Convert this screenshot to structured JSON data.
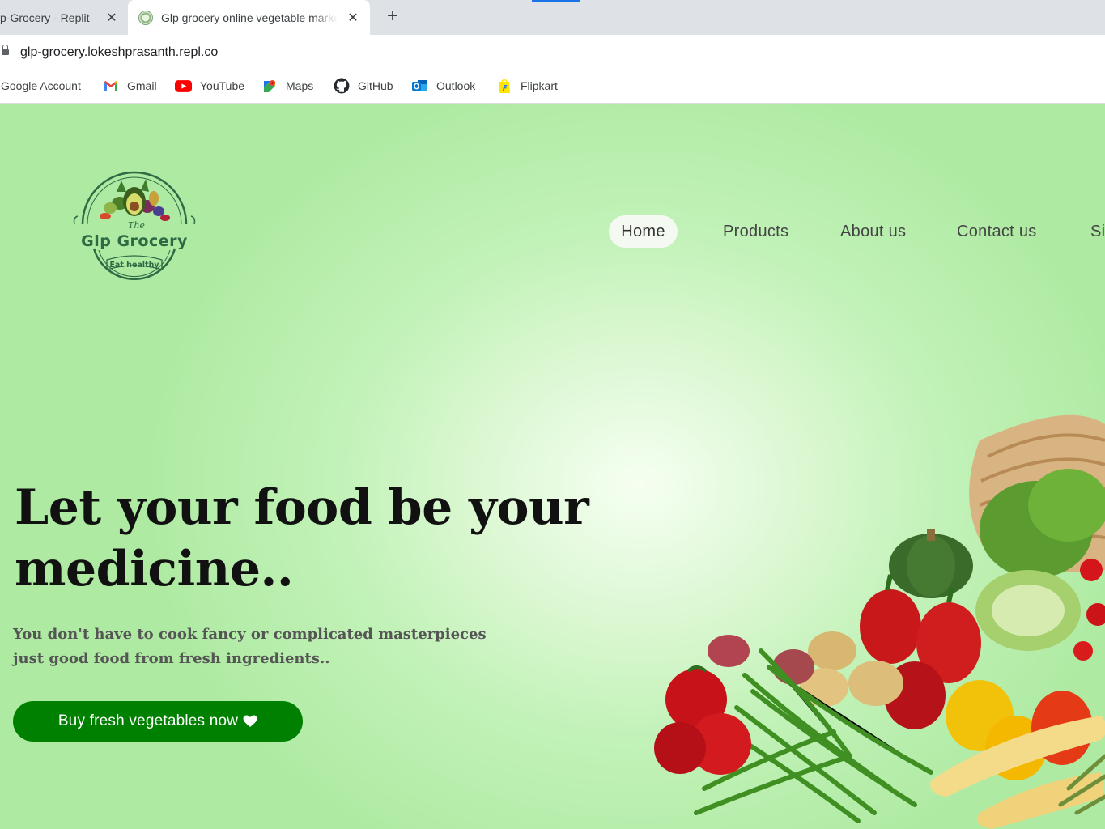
{
  "browser": {
    "tabs": [
      {
        "title": "p-Grocery - Replit"
      },
      {
        "title": "Glp grocery online vegetable market"
      }
    ],
    "url": "glp-grocery.lokeshprasanth.repl.co",
    "bookmarks": [
      {
        "label": "Google Account",
        "icon": "google-account-icon"
      },
      {
        "label": "Gmail",
        "icon": "gmail-icon"
      },
      {
        "label": "YouTube",
        "icon": "youtube-icon"
      },
      {
        "label": "Maps",
        "icon": "maps-icon"
      },
      {
        "label": "GitHub",
        "icon": "github-icon"
      },
      {
        "label": "Outlook",
        "icon": "outlook-icon"
      },
      {
        "label": "Flipkart",
        "icon": "flipkart-icon"
      }
    ]
  },
  "site": {
    "logo": {
      "the": "The",
      "title": "Glp Grocery",
      "tagline": "Eat healthy"
    },
    "nav": [
      {
        "label": "Home",
        "active": true
      },
      {
        "label": "Products"
      },
      {
        "label": "About us"
      },
      {
        "label": "Contact us"
      },
      {
        "label": "Si"
      }
    ],
    "hero": {
      "title": "Let your food be your medicine..",
      "subtitle_line1": "You don't have to cook fancy or complicated masterpieces",
      "subtitle_line2": "just good food from fresh ingredients..",
      "cta": "Buy fresh vegetables now"
    }
  },
  "colors": {
    "accent": "#008000",
    "background": "#c2f2b8",
    "logo_green": "#2e6a44"
  }
}
